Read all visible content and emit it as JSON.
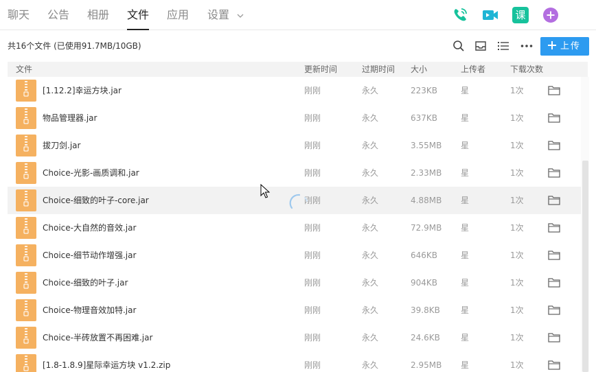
{
  "nav": {
    "tabs": [
      {
        "label": "聊天"
      },
      {
        "label": "公告"
      },
      {
        "label": "相册"
      },
      {
        "label": "文件"
      },
      {
        "label": "应用"
      },
      {
        "label": "设置"
      }
    ],
    "active_tab": "文件",
    "right_icons": [
      "phone-icon",
      "video-icon",
      "course-icon",
      "add-circle-icon"
    ],
    "course_icon_text": "课"
  },
  "toolbar": {
    "summary": "共16个文件 (已使用91.7MB/10GB)",
    "icons": [
      "search-icon",
      "inbox-icon",
      "list-icon",
      "more-icon"
    ],
    "upload_label": "上传"
  },
  "table": {
    "columns": {
      "name": "文件",
      "updated": "更新时间",
      "expires": "过期时间",
      "size": "大小",
      "uploader": "上传者",
      "downloads": "下载次数"
    },
    "rows": [
      {
        "name": "[1.12.2]幸运方块.jar",
        "updated": "刚刚",
        "expires": "永久",
        "size": "223KB",
        "uploader": "星",
        "downloads": "1次"
      },
      {
        "name": "物品管理器.jar",
        "updated": "刚刚",
        "expires": "永久",
        "size": "637KB",
        "uploader": "星",
        "downloads": "1次"
      },
      {
        "name": "拔刀剑.jar",
        "updated": "刚刚",
        "expires": "永久",
        "size": "3.55MB",
        "uploader": "星",
        "downloads": "1次"
      },
      {
        "name": "Choice-光影-画质调和.jar",
        "updated": "刚刚",
        "expires": "永久",
        "size": "2.33MB",
        "uploader": "星",
        "downloads": "1次"
      },
      {
        "name": "Choice-细致的叶子-core.jar",
        "updated": "刚刚",
        "expires": "永久",
        "size": "4.88MB",
        "uploader": "星",
        "downloads": "1次"
      },
      {
        "name": "Choice-大自然的音效.jar",
        "updated": "刚刚",
        "expires": "永久",
        "size": "72.9MB",
        "uploader": "星",
        "downloads": "1次"
      },
      {
        "name": "Choice-细节动作增强.jar",
        "updated": "刚刚",
        "expires": "永久",
        "size": "646KB",
        "uploader": "星",
        "downloads": "1次"
      },
      {
        "name": "Choice-细致的叶子.jar",
        "updated": "刚刚",
        "expires": "永久",
        "size": "904KB",
        "uploader": "星",
        "downloads": "1次"
      },
      {
        "name": "Choice-物理音效加特.jar",
        "updated": "刚刚",
        "expires": "永久",
        "size": "39.8KB",
        "uploader": "星",
        "downloads": "1次"
      },
      {
        "name": "Choice-半砖放置不再困难.jar",
        "updated": "刚刚",
        "expires": "永久",
        "size": "24.6KB",
        "uploader": "星",
        "downloads": "1次"
      },
      {
        "name": "[1.8-1.8.9]星际幸运方块 v1.2.zip",
        "updated": "刚刚",
        "expires": "永久",
        "size": "2.95MB",
        "uploader": "星",
        "downloads": "1次"
      }
    ],
    "hover_row": 4
  },
  "colors": {
    "accent": "#2d9bf0",
    "file_icon": "#f5b160",
    "phone_icon": "#17c29c",
    "video_icon": "#1fb5d5",
    "course_icon": "#17c29c",
    "add_icon": "#b36ee0"
  }
}
